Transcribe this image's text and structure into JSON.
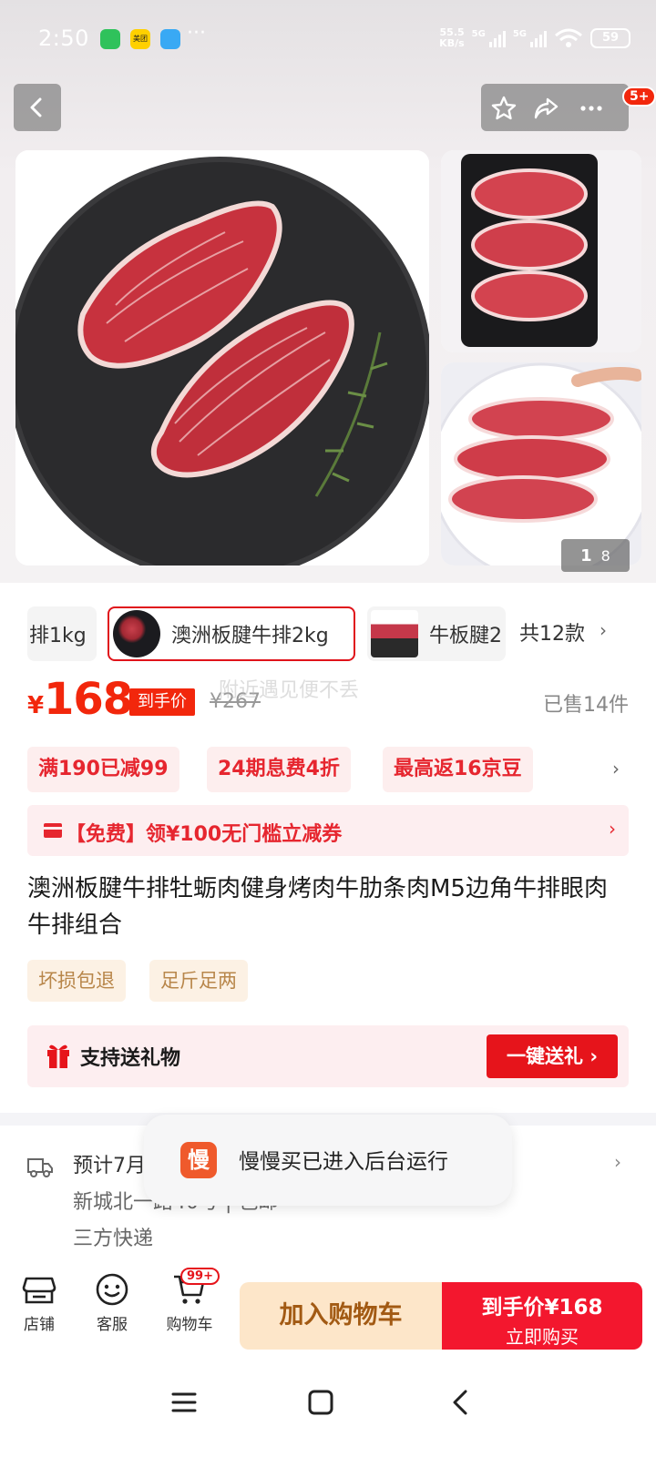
{
  "status_bar": {
    "time": "2:50",
    "apps": [
      "wechat-icon",
      "meituan-icon",
      "app-icon"
    ],
    "meituan_label": "美团",
    "more": "···",
    "net_speed_value": "55.5",
    "net_speed_unit": "KB/s",
    "signal1_label": "5G",
    "signal2_label": "5G",
    "wifi_label": "6",
    "battery": "59"
  },
  "header": {
    "notification_badge": "5+"
  },
  "gallery": {
    "current": "1",
    "total": "8"
  },
  "variants": {
    "items": [
      {
        "label": "排1kg"
      },
      {
        "label": "澳洲板腱牛排2kg"
      },
      {
        "label": "牛板腱2"
      }
    ],
    "total_label": "共12款",
    "arrow": "›"
  },
  "price": {
    "currency": "¥",
    "value": "168",
    "tag": "到手价",
    "original": "¥267",
    "overlay_text": "附近遇见便不丢",
    "sold": "已售14件"
  },
  "promos": {
    "items": [
      {
        "label": "满190已减99"
      },
      {
        "label": "24期息费4折"
      },
      {
        "label": "最高返16京豆"
      }
    ],
    "arrow": "›"
  },
  "coupon": {
    "text": "【免费】领¥100无门槛立减券",
    "arrow": "›"
  },
  "product": {
    "title": "澳洲板腱牛排牡蛎肉健身烤肉牛肋条肉M5边角牛排眼肉牛排组合"
  },
  "tags": [
    "坏损包退",
    "足斤足两"
  ],
  "gift": {
    "label": "支持送礼物",
    "button": "一键送礼 ›"
  },
  "shipping": {
    "line1": "预计7月",
    "line2": "新城北一路40号 | 包邮",
    "line3": "三方快递",
    "arrow": "›"
  },
  "toast": {
    "icon_char": "慢",
    "text": "慢慢买已进入后台运行"
  },
  "bottom_bar": {
    "store": "店铺",
    "service": "客服",
    "cart": "购物车",
    "cart_badge": "99+",
    "add_to_cart": "加入购物车",
    "buy_price": "到手价¥168",
    "buy_now": "立即购买"
  },
  "colors": {
    "accent_red": "#f2270c",
    "promo_bg": "#fdeeee",
    "cart_btn_bg": "#fde6c9",
    "buy_btn_bg": "#f3172e"
  }
}
